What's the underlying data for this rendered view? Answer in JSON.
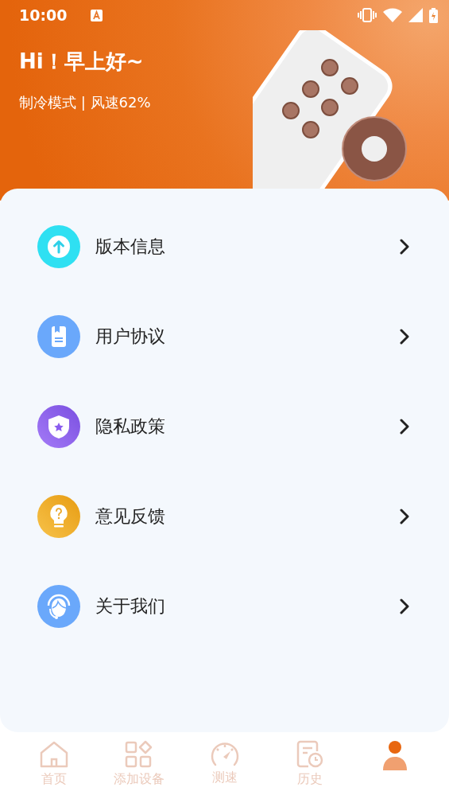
{
  "status_bar": {
    "time": "10:00"
  },
  "header": {
    "greeting": "Hi！早上好~",
    "subtitle": "制冷模式 | 风速62%"
  },
  "menu": [
    {
      "kind": "upload",
      "label": "版本信息"
    },
    {
      "kind": "document",
      "label": "用户协议"
    },
    {
      "kind": "shield",
      "label": "隐私政策"
    },
    {
      "kind": "bulb",
      "label": "意见反馈"
    },
    {
      "kind": "headset",
      "label": "关于我们"
    }
  ],
  "tabs": [
    {
      "kind": "home",
      "label": "首页",
      "selected": false
    },
    {
      "kind": "grid",
      "label": "添加设备",
      "selected": false
    },
    {
      "kind": "gauge",
      "label": "测速",
      "selected": false
    },
    {
      "kind": "history",
      "label": "历史",
      "selected": false
    },
    {
      "kind": "person",
      "selected": true
    }
  ]
}
